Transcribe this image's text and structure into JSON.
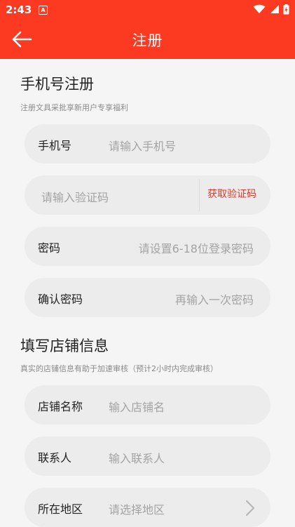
{
  "status": {
    "time": "2:43",
    "notif_icon": "A"
  },
  "header": {
    "title": "注册"
  },
  "section1": {
    "title": "手机号注册",
    "subtitle": "注册文具采批享新用户专享福利",
    "phone": {
      "label": "手机号",
      "placeholder": "请输入手机号"
    },
    "code": {
      "placeholder": "请输入验证码",
      "button": "获取验证码"
    },
    "password": {
      "label": "密码",
      "placeholder": "请设置6-18位登录密码"
    },
    "confirm": {
      "label": "确认密码",
      "placeholder": "再输入一次密码"
    }
  },
  "section2": {
    "title": "填写店铺信息",
    "subtitle": "真实的店铺信息有助于加速审核（预计2小时内完成审核）",
    "store": {
      "label": "店铺名称",
      "placeholder": "输入店铺名"
    },
    "contact": {
      "label": "联系人",
      "placeholder": "输入联系人"
    },
    "region": {
      "label": "所在地区",
      "placeholder": "请选择地区"
    }
  },
  "colors": {
    "brand": "#fb3a21",
    "link": "#e0392a"
  }
}
